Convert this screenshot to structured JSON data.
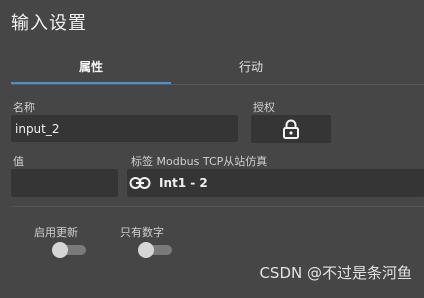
{
  "header": {
    "title": "输入设置"
  },
  "tabs": {
    "properties": "属性",
    "action": "行动"
  },
  "form": {
    "name_label": "名称",
    "name_value": "input_2",
    "auth_label": "授权",
    "value_label": "值",
    "value_value": "",
    "tag_label": "标签 Modbus TCP从站仿真",
    "tag_value": "Int1 - 2"
  },
  "toggles": {
    "enable_update_label": "启用更新",
    "enable_update_on": false,
    "numbers_only_label": "只有数字",
    "numbers_only_on": false
  },
  "watermark": "CSDN @不过是条河鱼",
  "colors": {
    "background": "#464646",
    "field": "#353535",
    "tab_accent": "#4a90d9"
  }
}
